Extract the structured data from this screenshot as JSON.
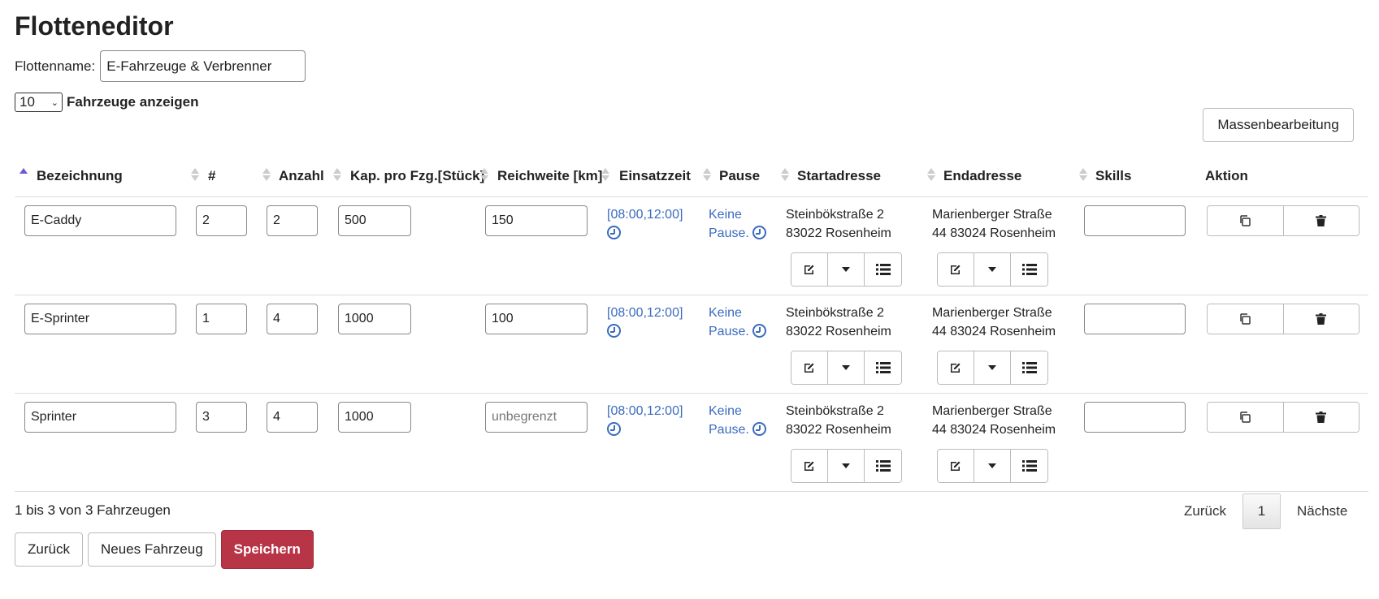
{
  "page": {
    "title": "Flotteneditor"
  },
  "fleet": {
    "label": "Flottenname:",
    "value": "E-Fahrzeuge & Verbrenner"
  },
  "length": {
    "value": "10",
    "label": "Fahrzeuge anzeigen"
  },
  "bulk_edit_label": "Massenbearbeitung",
  "columns": {
    "bezeichnung": "Bezeichnung",
    "nummer": "#",
    "anzahl": "Anzahl",
    "kapazitaet": "Kap. pro Fzg.[Stück]",
    "reichweite": "Reichweite [km]",
    "einsatzzeit": "Einsatzzeit",
    "pause": "Pause",
    "startadresse": "Startadresse",
    "endadresse": "Endadresse",
    "skills": "Skills",
    "aktion": "Aktion"
  },
  "rows": [
    {
      "bezeichnung": "E-Caddy",
      "nummer": "2",
      "anzahl": "2",
      "kapazitaet": "500",
      "reichweite": "150",
      "reichweite_placeholder": "",
      "einsatzzeit": "[08:00,12:00]",
      "pause_1": "Keine",
      "pause_2": "Pause.",
      "start_1": "Steinbökstraße 2",
      "start_2": "83022 Rosenheim",
      "end_1": "Marienberger Straße",
      "end_2": "44 83024 Rosenheim",
      "skills": ""
    },
    {
      "bezeichnung": "E-Sprinter",
      "nummer": "1",
      "anzahl": "4",
      "kapazitaet": "1000",
      "reichweite": "100",
      "reichweite_placeholder": "",
      "einsatzzeit": "[08:00,12:00]",
      "pause_1": "Keine",
      "pause_2": "Pause.",
      "start_1": "Steinbökstraße 2",
      "start_2": "83022 Rosenheim",
      "end_1": "Marienberger Straße",
      "end_2": "44 83024 Rosenheim",
      "skills": ""
    },
    {
      "bezeichnung": "Sprinter",
      "nummer": "3",
      "anzahl": "4",
      "kapazitaet": "1000",
      "reichweite": "",
      "reichweite_placeholder": "unbegrenzt",
      "einsatzzeit": "[08:00,12:00]",
      "pause_1": "Keine",
      "pause_2": "Pause.",
      "start_1": "Steinbökstraße 2",
      "start_2": "83022 Rosenheim",
      "end_1": "Marienberger Straße",
      "end_2": "44 83024 Rosenheim",
      "skills": ""
    }
  ],
  "info": "1 bis 3 von 3 Fahrzeugen",
  "pager": {
    "prev": "Zurück",
    "current": "1",
    "next": "Nächste"
  },
  "footer": {
    "back": "Zurück",
    "new_vehicle": "Neues Fahrzeug",
    "save": "Speichern"
  },
  "icons": {
    "edit": "edit-icon",
    "dropdown": "caret-down-icon",
    "list": "list-icon",
    "copy": "copy-icon",
    "delete": "trash-icon",
    "clock": "clock-icon",
    "sort": "sort-icon",
    "sort_asc": "sort-asc-icon"
  },
  "colors": {
    "link": "#3a6bbf",
    "primary": "#b83547",
    "sort_active": "#6b5bd6"
  }
}
